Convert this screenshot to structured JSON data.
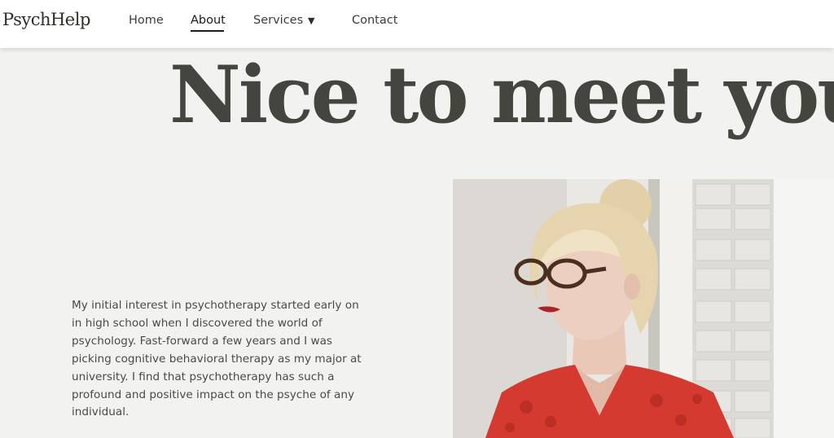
{
  "nav": {
    "logo": "PsychHelp",
    "links": {
      "home": "Home",
      "about": "About",
      "services": "Services",
      "contact": "Contact"
    },
    "services_caret": "▼",
    "active": "About"
  },
  "hero": {
    "headline": "Nice to meet you"
  },
  "bio": {
    "text": "My initial interest in psychotherapy started early on in high school when I discovered the world of psychology. Fast-forward a few years and I was picking cognitive behavioral therapy as my major at university. I find that psychotherapy has such a profound and positive impact on the psyche of any individual."
  },
  "colors": {
    "background": "#f2f2f0",
    "text": "#45453f",
    "dress": "#d43a2f"
  }
}
